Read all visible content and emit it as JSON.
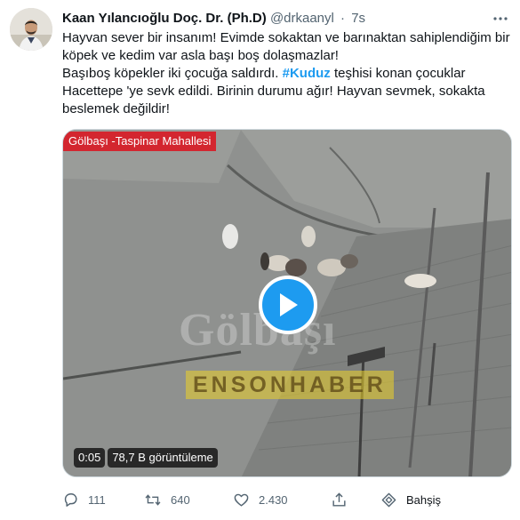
{
  "author": {
    "name": "Kaan Yılancıoğlu Doç. Dr. (Ph.D)",
    "handle": "@drkaanyl",
    "separator": "·",
    "time": "7s"
  },
  "body": {
    "line1": "Hayvan sever bir insanım! Evimde sokaktan ve barınaktan sahiplendiğim bir köpek ve kedim var asla başı boş dolaşmazlar!",
    "line2_before": "Başıboş köpekler iki çocuğa saldırdı. ",
    "hashtag": "#Kuduz",
    "line2_after": " teşhisi konan çocuklar Hacettepe 'ye sevk edildi. Birinin durumu ağır! Hayvan sevmek, sokakta beslemek değildir!"
  },
  "media": {
    "location_tag": "Gölbaşı -Taspinar Mahallesi",
    "watermark_top": "Gölbaşı",
    "watermark_bottom": "ENSONHABER",
    "duration": "0:05",
    "views": "78,7 B görüntüleme"
  },
  "actions": {
    "replies": "111",
    "retweets": "640",
    "likes": "2.430",
    "tip_label": "Bahşiş"
  },
  "colors": {
    "accent": "#1d9bf0",
    "text": "#0f1419",
    "secondary": "#536471",
    "tag_red": "#d3262f"
  },
  "icons": {
    "more": "more-dots-icon",
    "play": "play-icon",
    "reply": "reply-icon",
    "retweet": "retweet-icon",
    "like": "heart-icon",
    "share": "share-icon",
    "tip": "tip-icon"
  }
}
